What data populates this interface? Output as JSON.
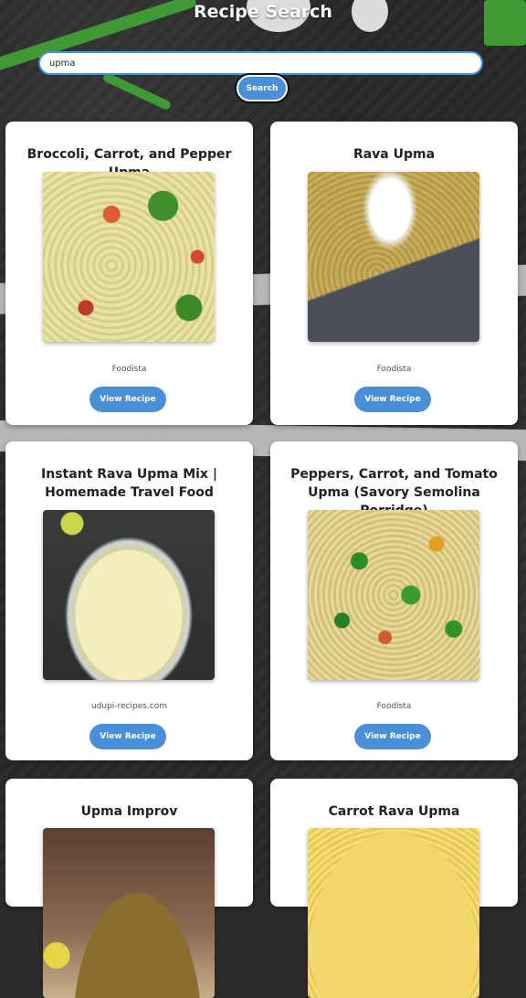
{
  "header": {
    "title": "Recipe Search",
    "search_value": "upma",
    "search_button_label": "Search"
  },
  "recipes": [
    {
      "title": "Broccoli, Carrot, and Pepper Upma",
      "source": "Foodista",
      "button": "View Recipe",
      "image_icon": "broccoli-carrot-pepper-upma-photo"
    },
    {
      "title": "Rava Upma",
      "source": "Foodista",
      "button": "View Recipe",
      "image_icon": "rava-upma-photo"
    },
    {
      "title": "Instant Rava Upma Mix | Homemade Travel Food",
      "source": "udupi-recipes.com",
      "button": "View Recipe",
      "image_icon": "instant-rava-upma-mix-photo"
    },
    {
      "title": "Peppers, Carrot, and Tomato Upma (Savory Semolina Porridge)",
      "source": "Foodista",
      "button": "View Recipe",
      "image_icon": "peppers-carrot-tomato-upma-photo"
    },
    {
      "title": "Upma Improv",
      "source": "",
      "button": "",
      "image_icon": "upma-improv-photo"
    },
    {
      "title": "Carrot Rava Upma",
      "source": "",
      "button": "",
      "image_icon": "carrot-rava-upma-photo"
    }
  ],
  "colors": {
    "accent": "#4a90d9",
    "background": "#2b2b2b",
    "card": "#ffffff"
  }
}
